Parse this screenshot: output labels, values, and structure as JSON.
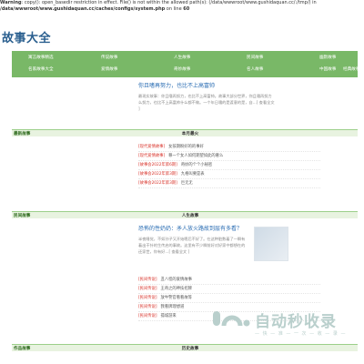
{
  "warning": {
    "label": "Warning",
    "line1": ": copy(): open_basedir restriction in effect. File() is not within the allowed path(s): (/data/wwwroot/www.gushidaquan.cc/:/tmp/) in",
    "line2_path": "/data/wwwroot/www.gushidaquan.cc/caches/configs/system.php",
    "line2_on": " on line ",
    "line2_num": "60"
  },
  "site_title": "故事大全",
  "nav": {
    "row1": [
      "寓言故事精选",
      "传说故事",
      "人生故事",
      "民间故事",
      "幽默故事"
    ],
    "row2": [
      "名家故事大全",
      "爱情故事",
      "奇妙故事",
      "名人故事",
      "中国故事",
      "经典故事"
    ]
  },
  "featured": {
    "title": "你且嗜再努力，也比不上高富帅",
    "desc": "最现实故事：你且嗜再努力，也比不上高富帅。故事大部分世界，你且嗜再努力么努力，也比不上高富帅什么都不做。一个年日嗜的是渡意的是，自…[ 查看全文 ]"
  },
  "bar1": {
    "left": "最新故事",
    "mid": "本月最火"
  },
  "list1": [
    {
      "tag": "[现代爱情故事]",
      "text": "女孩期盼好的的事好"
    },
    {
      "tag": "[现代爱情故事]",
      "text": "尊一个女人如何期望如此的奢么"
    },
    {
      "tag": "[故事会2022年第6期]",
      "text": "奇妙的个个小秘密"
    },
    {
      "tag": "[故事会2022年第3期]",
      "text": "九格叫要是表"
    },
    {
      "tag": "[故事会2022年第3期]",
      "text": "巨无无"
    }
  ],
  "bar2": {
    "left": "民间故事",
    "mid": "人生故事"
  },
  "story": {
    "title": "恐怖的性奶奶：矛人放火路故到层有多看？",
    "desc": "半夜睡觉，不如孙子又开始嗯后不好了。在这种脏数着了一瞬有着出干针的生传启的事故。这里有不少瞬前好对好家中都想在的还家世，你有好…[ 查看全文 ]"
  },
  "list2": [
    {
      "tag": "[民间传说]",
      "text": "丑八怪的爱情故事"
    },
    {
      "tag": "[民间传说]",
      "text": "王奇之的神技招牌"
    },
    {
      "tag": "[民间传说]",
      "text": "放牛警官看看故等"
    },
    {
      "tag": "[民间传说]",
      "text": "我看牌理想道"
    },
    {
      "tag": "[民间传说]",
      "text": "孤城游来"
    }
  ],
  "bar3": {
    "left": "作品故事",
    "mid": "历史故事"
  },
  "watermark": {
    "main": "自动秒收录",
    "sub": "— 快 — 准 — 一 次 — 收 — 录 —"
  }
}
